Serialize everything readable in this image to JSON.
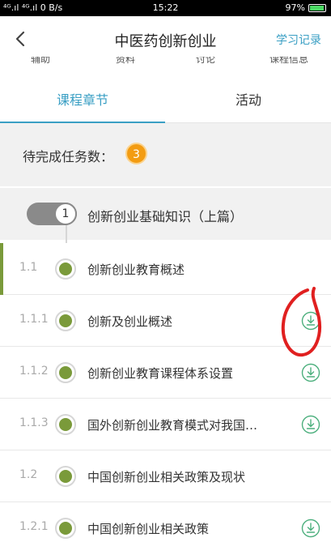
{
  "status": {
    "left": "⁴ᴳ.ıl ⁴ᴳ.ıl 0 B/s",
    "time": "15:22",
    "battery": "97%",
    "battery_fraction": 0.97
  },
  "nav": {
    "back_icon": "chevron-left-icon",
    "title": "中医药创新创业",
    "record_link": "学习记录"
  },
  "subnav": [
    "辅助",
    "资料",
    "讨论",
    "课程信息"
  ],
  "tabs": [
    {
      "label": "课程章节",
      "active": true
    },
    {
      "label": "活动",
      "active": false
    }
  ],
  "pending": {
    "label": "待完成任务数：",
    "count": "3"
  },
  "chapter": {
    "number": "1",
    "title": "创新创业基础知识（上篇）"
  },
  "sections": [
    {
      "num": "1.1",
      "title": "创新创业教育概述",
      "download": false,
      "active": true
    },
    {
      "num": "1.1.1",
      "title": "创新及创业概述",
      "download": true,
      "active": false
    },
    {
      "num": "1.1.2",
      "title": "创新创业教育课程体系设置",
      "download": true,
      "active": false
    },
    {
      "num": "1.1.3",
      "title": "国外创新创业教育模式对我国…",
      "download": true,
      "active": false
    },
    {
      "num": "1.2",
      "title": "中国创新创业相关政策及现状",
      "download": false,
      "active": false
    },
    {
      "num": "1.2.1",
      "title": "中国创新创业相关政策",
      "download": true,
      "active": false
    }
  ],
  "colors": {
    "accent": "#3a9fc4",
    "node_green": "#7a9a3a",
    "badge_orange": "#f39c12",
    "annotation_red": "#e02020"
  }
}
